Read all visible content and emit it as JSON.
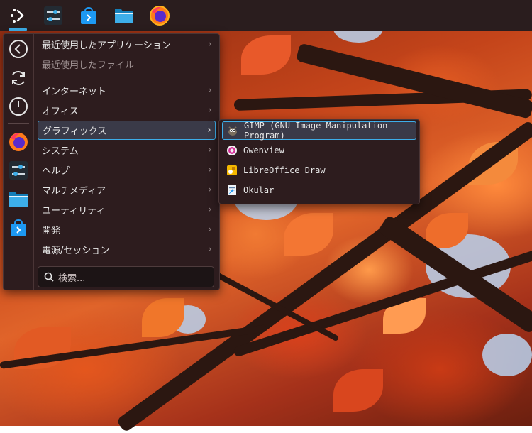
{
  "taskbar": {
    "items": [
      {
        "name": "application-launcher",
        "icon": "kde-launcher-icon"
      },
      {
        "name": "system-settings",
        "icon": "settings-sliders-icon"
      },
      {
        "name": "discover",
        "icon": "store-bag-icon"
      },
      {
        "name": "dolphin",
        "icon": "folder-icon"
      },
      {
        "name": "firefox",
        "icon": "firefox-icon"
      }
    ],
    "accent": "#3daee9"
  },
  "launcher": {
    "favorites": [
      {
        "name": "back",
        "icon": "back-circle-icon"
      },
      {
        "name": "restart",
        "icon": "refresh-icon"
      },
      {
        "name": "shutdown",
        "icon": "power-icon"
      },
      {
        "name": "firefox",
        "icon": "firefox-icon"
      },
      {
        "name": "system-settings",
        "icon": "settings-sliders-icon"
      },
      {
        "name": "dolphin",
        "icon": "folder-icon"
      },
      {
        "name": "discover",
        "icon": "store-bag-icon"
      }
    ],
    "recent_apps": "最近使用したアプリケーション",
    "recent_files": "最近使用したファイル",
    "categories": [
      "インターネット",
      "オフィス",
      "グラフィックス",
      "システム",
      "ヘルプ",
      "マルチメディア",
      "ユーティリティ",
      "開発",
      "電源/セッション"
    ],
    "selected_category": "グラフィックス",
    "search_placeholder": "検索..."
  },
  "graphics_submenu": {
    "items": [
      {
        "label": "GIMP (GNU Image Manipulation Program)",
        "icon": "gimp-icon"
      },
      {
        "label": "Gwenview",
        "icon": "gwenview-icon"
      },
      {
        "label": "LibreOffice Draw",
        "icon": "libreoffice-draw-icon"
      },
      {
        "label": "Okular",
        "icon": "okular-icon"
      }
    ],
    "selected": "GIMP (GNU Image Manipulation Program)"
  }
}
